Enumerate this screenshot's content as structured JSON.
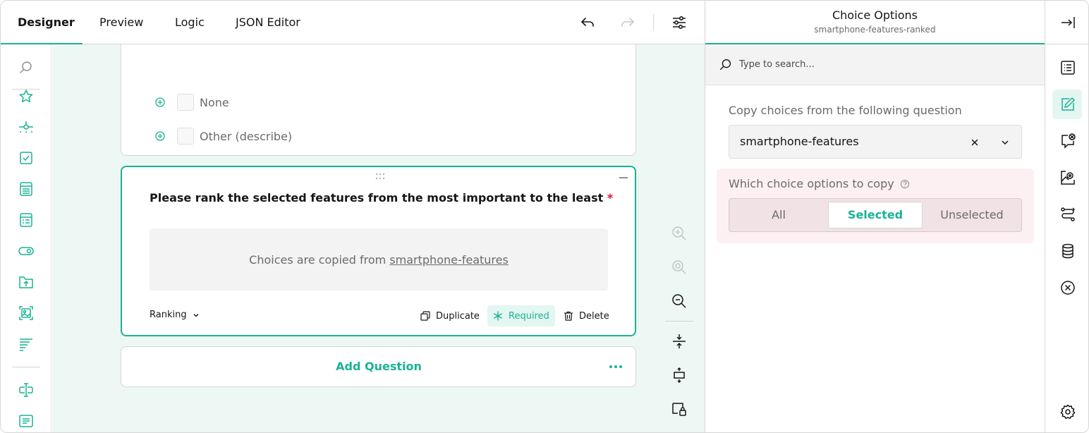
{
  "topbar": {
    "tabs": [
      {
        "label": "Designer",
        "active": true
      },
      {
        "label": "Preview",
        "active": false
      },
      {
        "label": "Logic",
        "active": false
      },
      {
        "label": "JSON Editor",
        "active": false
      }
    ],
    "icons": [
      "undo-icon",
      "redo-icon",
      "settings-sliders-icon"
    ]
  },
  "toolbox": {
    "icons": [
      "search-icon",
      "rating-star-icon",
      "slider-icon",
      "checkbox-icon",
      "dropdown-list-icon",
      "multi-select-icon",
      "toggle-icon",
      "file-upload-icon",
      "image-picker-icon",
      "ranking-icon",
      "text-input-icon",
      "comment-icon"
    ]
  },
  "canvas": {
    "previous_choices": [
      "None",
      "Other (describe)"
    ],
    "question": {
      "title": "Please rank the selected features from the most important to the least",
      "required_mark": "*",
      "copied_prefix": "Choices are copied from",
      "copied_source": "smartphone-features",
      "type_label": "Ranking",
      "actions": {
        "duplicate": "Duplicate",
        "required": "Required",
        "delete": "Delete"
      }
    },
    "add_question": "Add Question",
    "zoom_icons": [
      "zoom-in-icon",
      "zoom-to-fit-icon",
      "zoom-out-icon",
      "collapse-all-icon",
      "expand-all-icon",
      "lock-question-icon"
    ]
  },
  "panel": {
    "title": "Choice Options",
    "subtitle": "smartphone-features-ranked",
    "search_placeholder": "Type to search...",
    "copy_from_label": "Copy choices from the following question",
    "copy_from_value": "smartphone-features",
    "which_label": "Which choice options to copy",
    "options": [
      {
        "label": "All",
        "selected": false
      },
      {
        "label": "Selected",
        "selected": true
      },
      {
        "label": "Unselected",
        "selected": false
      }
    ]
  },
  "rail": {
    "icons": [
      "collapse-panel-icon",
      "general-list-icon",
      "choice-edit-icon",
      "conditions-icon",
      "validation-icon",
      "logic-flow-icon",
      "data-icon",
      "clear-icon",
      "settings-gear-icon"
    ],
    "active": "choice-edit-icon"
  },
  "colors": {
    "accent": "#19b394",
    "canvas_bg": "#edf7f4",
    "required_red": "#e60a3e",
    "warning_bg": "#fdf0f2"
  }
}
